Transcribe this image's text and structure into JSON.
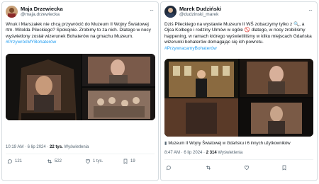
{
  "tweets": [
    {
      "author": "Maja Drzewiecka",
      "handle": "@maja.drzewiecka",
      "text": "Wnuk i Marszałek nie chcą przywrócić do Muzeum II Wojny Światowej rtm. Witolda Pileckiego? Spokojnie. Zrobimy to za nich. Dlatego w nocy wyświetlony został wizerunek Bohaterów na gmachu Muzeum.",
      "hashtag": "#PrzywróćMYBohaterów",
      "time": "10:19 AM · 6 lip 2024 ·",
      "views": "22 tys.",
      "views_label": "Wyświetlenia",
      "actions": {
        "replies": "121",
        "reposts": "522",
        "likes": "1 tys.",
        "bookmarks": "19"
      }
    },
    {
      "author": "Marek Dudziński",
      "handle": "@dudzinski_marek",
      "text": "Dziś Pileckiego na wystawie Muzeum II WŚ zobaczymy tylko z 🔍, a Ojca Kolbego i rodziny Ulmów w ogóle 🚫 dlatego, w nocy zrobiliśmy happening, w ramach którego wyświetliliśmy w kilku miejscach Gdańska wizerunki bohaterów domagając się ich powrotu.",
      "hashtag": "#PrzywracamyBohaterów",
      "location": "Muzeum II Wojny Światowej w Gdańsku i 6 innych użytkowników",
      "time": "8:47 AM · 6 lip 2024 ·",
      "views": "2 314",
      "views_label": "Wyświetlenia",
      "actions": {
        "replies": "",
        "reposts": "",
        "likes": "",
        "bookmarks": ""
      }
    }
  ],
  "colors": {
    "link": "#1d9bf0",
    "muted": "#536471",
    "text": "#0f1419"
  },
  "icons": [
    "more-icon",
    "reply-icon",
    "repost-icon",
    "like-icon",
    "bookmark-icon",
    "location-pin-icon"
  ]
}
